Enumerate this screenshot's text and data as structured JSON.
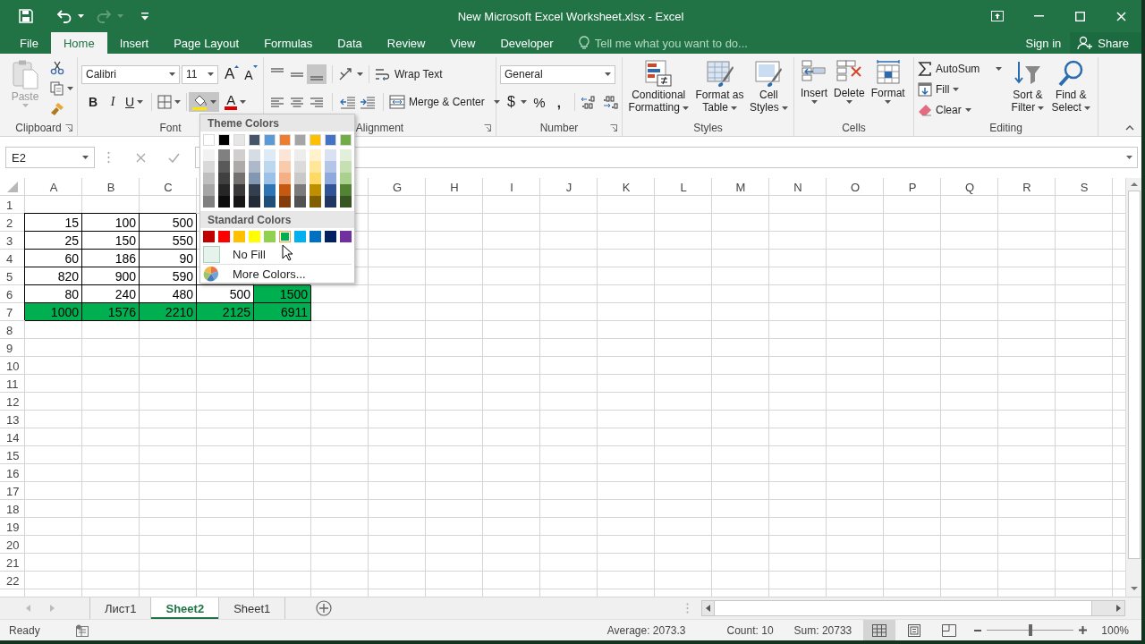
{
  "window": {
    "title": "New Microsoft Excel Worksheet.xlsx - Excel"
  },
  "menu_tabs": [
    {
      "label": "File",
      "selected": false
    },
    {
      "label": "Home",
      "selected": true
    },
    {
      "label": "Insert",
      "selected": false
    },
    {
      "label": "Page Layout",
      "selected": false
    },
    {
      "label": "Formulas",
      "selected": false
    },
    {
      "label": "Data",
      "selected": false
    },
    {
      "label": "Review",
      "selected": false
    },
    {
      "label": "View",
      "selected": false
    },
    {
      "label": "Developer",
      "selected": false
    }
  ],
  "tell_me": {
    "placeholder": "Tell me what you want to do..."
  },
  "account": {
    "sign_in": "Sign in",
    "share": "Share"
  },
  "ribbon": {
    "clipboard": {
      "paste": {
        "label": "Paste",
        "disabled": true
      },
      "group_label": "Clipboard"
    },
    "font": {
      "font_name": "Calibri",
      "font_size": "11",
      "grow_font": "A",
      "shrink_font": "A",
      "bold": "B",
      "italic": "I",
      "underline": "U",
      "fill_color": {
        "pressed": true
      },
      "font_color": "A",
      "group_label": "Font"
    },
    "alignment": {
      "vertical": [
        {
          "selected": false
        },
        {
          "selected": false
        },
        {
          "selected": true
        }
      ],
      "wrap_text": "Wrap Text",
      "merge": "Merge & Center",
      "group_label": "Alignment"
    },
    "number": {
      "format": "General",
      "currency": "$",
      "percent": "%",
      "comma": ",",
      "group_label": "Number"
    },
    "styles": {
      "buttons": [
        "Conditional Formatting",
        "Format as Table",
        "Cell Styles"
      ],
      "group_label": "Styles"
    },
    "cells": {
      "buttons": [
        "Insert",
        "Delete",
        "Format"
      ],
      "group_label": "Cells"
    },
    "editing": {
      "autosum": "AutoSum",
      "fill": "Fill",
      "clear": "Clear",
      "sort_filter": "Sort & Filter",
      "find_select": "Find & Select",
      "group_label": "Editing"
    }
  },
  "formula_bar": {
    "name_box": "E2"
  },
  "grid": {
    "columns_left": [
      "A",
      "B",
      "C"
    ],
    "columns_right": [
      "G",
      "H",
      "I",
      "J",
      "K",
      "L",
      "M",
      "N",
      "O",
      "P",
      "Q",
      "R",
      "S"
    ],
    "rows": [
      {
        "header": "1"
      },
      {
        "header": "2",
        "cells": [
          {
            "value": "15",
            "bordered": true,
            "highlighted": false
          },
          {
            "value": "100",
            "bordered": true,
            "highlighted": false
          },
          {
            "value": "500",
            "bordered": true,
            "highlighted": false
          }
        ]
      },
      {
        "header": "3",
        "cells": [
          {
            "value": "25",
            "bordered": true,
            "highlighted": false
          },
          {
            "value": "150",
            "bordered": true,
            "highlighted": false
          },
          {
            "value": "550",
            "bordered": true,
            "highlighted": false
          }
        ]
      },
      {
        "header": "4",
        "cells": [
          {
            "value": "60",
            "bordered": true,
            "highlighted": false
          },
          {
            "value": "186",
            "bordered": true,
            "highlighted": false
          },
          {
            "value": "90",
            "bordered": true,
            "highlighted": false
          }
        ]
      },
      {
        "header": "5",
        "cells": [
          {
            "value": "820",
            "bordered": true,
            "highlighted": false
          },
          {
            "value": "900",
            "bordered": true,
            "highlighted": false
          },
          {
            "value": "590",
            "bordered": true,
            "highlighted": false
          }
        ]
      },
      {
        "header": "6",
        "cells": [
          {
            "value": "80",
            "bordered": true,
            "highlighted": false
          },
          {
            "value": "240",
            "bordered": true,
            "highlighted": false
          },
          {
            "value": "480",
            "bordered": true,
            "highlighted": false
          },
          {
            "value": "500",
            "bordered": true,
            "highlighted": false
          },
          {
            "value": "1500",
            "bordered": true,
            "highlighted": true
          }
        ]
      },
      {
        "header": "7",
        "cells": [
          {
            "value": "1000",
            "bordered": true,
            "highlighted": true
          },
          {
            "value": "1576",
            "bordered": true,
            "highlighted": true
          },
          {
            "value": "2210",
            "bordered": true,
            "highlighted": true
          },
          {
            "value": "2125",
            "bordered": true,
            "highlighted": true
          },
          {
            "value": "6911",
            "bordered": true,
            "highlighted": true
          }
        ]
      },
      {
        "header": "8"
      },
      {
        "header": "9"
      },
      {
        "header": "10"
      },
      {
        "header": "11"
      },
      {
        "header": "12"
      },
      {
        "header": "13"
      },
      {
        "header": "14"
      },
      {
        "header": "15"
      },
      {
        "header": "16"
      },
      {
        "header": "17"
      },
      {
        "header": "18"
      },
      {
        "header": "19"
      },
      {
        "header": "20"
      },
      {
        "header": "21"
      },
      {
        "header": "22"
      }
    ]
  },
  "color_menu": {
    "theme_title": "Theme Colors",
    "theme": [
      {
        "color": "#ffffff",
        "shades": [
          {
            "color": "#f2f2f2"
          },
          {
            "color": "#d9d9d9"
          },
          {
            "color": "#bfbfbf"
          },
          {
            "color": "#a6a6a6"
          },
          {
            "color": "#808080"
          }
        ]
      },
      {
        "color": "#000000",
        "shades": [
          {
            "color": "#808080"
          },
          {
            "color": "#595959"
          },
          {
            "color": "#404040"
          },
          {
            "color": "#262626"
          },
          {
            "color": "#0d0d0d"
          }
        ]
      },
      {
        "color": "#e7e6e6",
        "shades": [
          {
            "color": "#d0cece"
          },
          {
            "color": "#aeaaaa"
          },
          {
            "color": "#757171"
          },
          {
            "color": "#3a3838"
          },
          {
            "color": "#171616"
          }
        ]
      },
      {
        "color": "#44546a",
        "shades": [
          {
            "color": "#d6dce4"
          },
          {
            "color": "#adb9ca"
          },
          {
            "color": "#8497b0"
          },
          {
            "color": "#333f4f"
          },
          {
            "color": "#222b35"
          }
        ]
      },
      {
        "color": "#5b9bd5",
        "shades": [
          {
            "color": "#ddebf7"
          },
          {
            "color": "#bdd7ee"
          },
          {
            "color": "#9bc2e6"
          },
          {
            "color": "#2f75b5"
          },
          {
            "color": "#1f4e78"
          }
        ]
      },
      {
        "color": "#ed7d31",
        "shades": [
          {
            "color": "#fce4d6"
          },
          {
            "color": "#f8cbad"
          },
          {
            "color": "#f4b084"
          },
          {
            "color": "#c65911"
          },
          {
            "color": "#833c0c"
          }
        ]
      },
      {
        "color": "#a5a5a5",
        "shades": [
          {
            "color": "#ededed"
          },
          {
            "color": "#dbdbdb"
          },
          {
            "color": "#c9c9c9"
          },
          {
            "color": "#7b7b7b"
          },
          {
            "color": "#525252"
          }
        ]
      },
      {
        "color": "#ffc000",
        "shades": [
          {
            "color": "#fff2cc"
          },
          {
            "color": "#ffe699"
          },
          {
            "color": "#ffd966"
          },
          {
            "color": "#bf8f00"
          },
          {
            "color": "#806000"
          }
        ]
      },
      {
        "color": "#4472c4",
        "shades": [
          {
            "color": "#d9e1f2"
          },
          {
            "color": "#b4c6e7"
          },
          {
            "color": "#8ea9db"
          },
          {
            "color": "#305496"
          },
          {
            "color": "#203764"
          }
        ]
      },
      {
        "color": "#70ad47",
        "shades": [
          {
            "color": "#e2efda"
          },
          {
            "color": "#c6e0b4"
          },
          {
            "color": "#a9d08e"
          },
          {
            "color": "#548235"
          },
          {
            "color": "#375623"
          }
        ]
      }
    ],
    "standard_title": "Standard Colors",
    "standard": [
      {
        "color": "#c00000",
        "selected": false
      },
      {
        "color": "#ff0000",
        "selected": false
      },
      {
        "color": "#ffc000",
        "selected": false
      },
      {
        "color": "#ffff00",
        "selected": false
      },
      {
        "color": "#92d050",
        "selected": false
      },
      {
        "color": "#00b050",
        "selected": true
      },
      {
        "color": "#00b0f0",
        "selected": false
      },
      {
        "color": "#0070c0",
        "selected": false
      },
      {
        "color": "#002060",
        "selected": false
      },
      {
        "color": "#7030a0",
        "selected": false
      }
    ],
    "no_fill": "No Fill",
    "more_colors": "More Colors..."
  },
  "sheet_tabs": [
    {
      "label": "Лист1",
      "selected": false
    },
    {
      "label": "Sheet2",
      "selected": true
    },
    {
      "label": "Sheet1",
      "selected": false
    }
  ],
  "status_bar": {
    "mode": "Ready",
    "average": "Average: 2073.3",
    "count": "Count: 10",
    "sum": "Sum: 20733",
    "views": [
      {
        "selected": true
      },
      {
        "selected": false
      },
      {
        "selected": false
      }
    ],
    "zoom_slider": {
      "level": 0.5
    },
    "zoom": "100%"
  }
}
